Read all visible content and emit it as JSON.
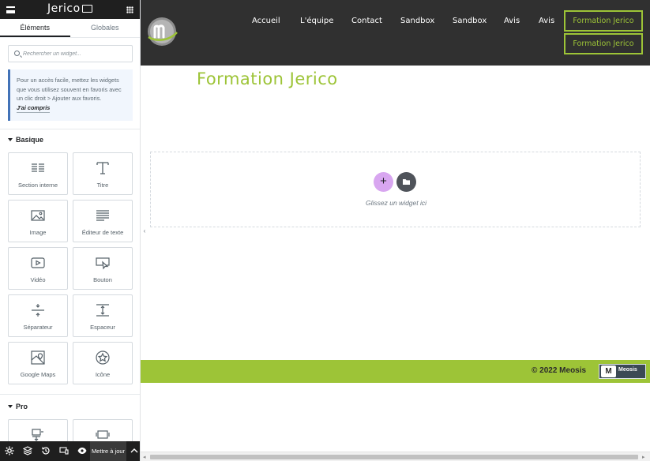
{
  "editor": {
    "brand": "Jerico",
    "tabs": [
      {
        "label": "Éléments",
        "active": true
      },
      {
        "label": "Globales",
        "active": false
      }
    ],
    "search": {
      "placeholder": "Rechercher un widget..."
    },
    "notice": {
      "text": "Pour un accès facile, mettez les widgets que vous utilisez souvent en favoris avec un clic droit > Ajouter aux favoris.",
      "dismiss": "J'ai compris"
    },
    "categories": {
      "basic": "Basique",
      "pro": "Pro"
    },
    "widgets": [
      {
        "label": "Section interne",
        "icon": "inner-section-icon"
      },
      {
        "label": "Titre",
        "icon": "heading-icon"
      },
      {
        "label": "Image",
        "icon": "image-icon"
      },
      {
        "label": "Éditeur de texte",
        "icon": "text-editor-icon"
      },
      {
        "label": "Vidéo",
        "icon": "video-icon"
      },
      {
        "label": "Bouton",
        "icon": "button-icon"
      },
      {
        "label": "Séparateur",
        "icon": "divider-icon"
      },
      {
        "label": "Espaceur",
        "icon": "spacer-icon"
      },
      {
        "label": "Google Maps",
        "icon": "google-maps-icon"
      },
      {
        "label": "Icône",
        "icon": "star-icon"
      }
    ],
    "footer": {
      "update_label": "Mettre à jour"
    }
  },
  "site": {
    "nav": [
      {
        "label": "Accueil"
      },
      {
        "label": "L'équipe"
      },
      {
        "label": "Contact"
      },
      {
        "label": "Sandbox"
      },
      {
        "label": "Sandbox"
      },
      {
        "label": "Avis"
      },
      {
        "label": "Avis"
      }
    ],
    "nav_buttons": [
      {
        "label": "Formation Jerico"
      },
      {
        "label": "Formation Jerico"
      }
    ],
    "page_title": "Formation Jerico",
    "drop_zone_text": "Glissez un widget ici",
    "copyright": "© 2022 Meosis",
    "footer_logo_text": "Meosis",
    "footer_logo_mark": "M",
    "colors": {
      "accent": "#9dc437",
      "header_bg": "#303030",
      "panel_dark": "#1f1f1f",
      "add_button": "#d8a6f0"
    }
  }
}
